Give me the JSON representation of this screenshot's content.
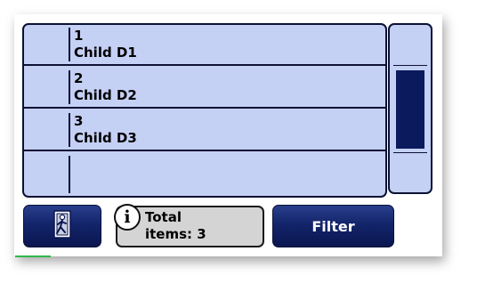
{
  "list": {
    "rows": [
      {
        "number": "1",
        "label": "Child D1"
      },
      {
        "number": "2",
        "label": "Child D2"
      },
      {
        "number": "3",
        "label": "Child D3"
      },
      {
        "number": "",
        "label": ""
      }
    ]
  },
  "scrollbar": {
    "position": 0,
    "thumb_fraction": 0.5
  },
  "toolbar": {
    "exit_icon": "exit-door-icon",
    "info_icon_glyph": "i",
    "info_line1": "Total",
    "info_line2": "items: 3",
    "filter_label": "Filter"
  },
  "colors": {
    "list_bg": "#c5d0f5",
    "accent_dark": "#0a1a5c",
    "info_bg": "#d4d4d4"
  }
}
